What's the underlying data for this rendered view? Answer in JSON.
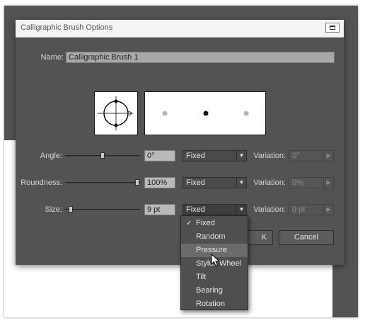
{
  "dialog": {
    "title": "Calligraphic Brush Options"
  },
  "name": {
    "label": "Name:",
    "value": "Calligraphic Brush 1"
  },
  "angle": {
    "label": "Angle:",
    "value": "0°",
    "mode": "Fixed",
    "variation_label": "Variation:",
    "variation_value": "0°"
  },
  "roundness": {
    "label": "Roundness:",
    "value": "100%",
    "mode": "Fixed",
    "variation_label": "Variation:",
    "variation_value": "0%"
  },
  "size": {
    "label": "Size:",
    "value": "9 pt",
    "mode": "Fixed",
    "variation_label": "Variation:",
    "variation_value": "0 pt"
  },
  "buttons": {
    "ok_label": "K",
    "cancel_label": "Cancel"
  },
  "dropdown_menu": {
    "items": [
      "Fixed",
      "Random",
      "Pressure",
      "Stylus Wheel",
      "Tilt",
      "Bearing",
      "Rotation"
    ],
    "checked": "Fixed",
    "hovered": "Pressure",
    "check_glyph": "✓"
  },
  "colors": {
    "dialog_bg": "#535353",
    "titlebar_bg": "#f4f4f4",
    "field_bg": "#b9b9b9"
  }
}
